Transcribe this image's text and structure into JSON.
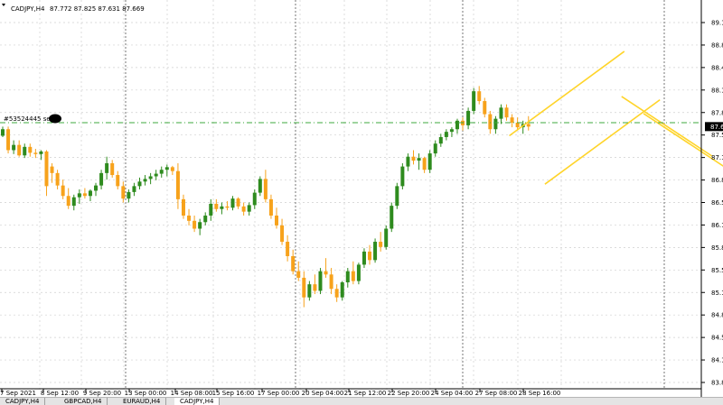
{
  "chart_data": {
    "type": "candlestick",
    "symbol_label": "CADJPY,H4",
    "ohlc_label": "87.772 87.825 87.631 87.669",
    "y_ticks": [
      "89.1",
      "88.8",
      "88.4",
      "88.1",
      "87.8",
      "87.5",
      "87.1",
      "86.8",
      "86.5",
      "86.1",
      "85.8",
      "85.5",
      "85.1",
      "84.8",
      "84.5",
      "84.1",
      "83.8"
    ],
    "current_price_label": "87.6",
    "x_ticks": [
      "7 Sep 2021",
      "8 Sep 12:00",
      "9 Sep 20:00",
      "13 Sep 00:00",
      "14 Sep 08:00",
      "15 Sep 16:00",
      "17 Sep 00:00",
      "20 Sep 04:00",
      "21 Sep 12:00",
      "22 Sep 20:00",
      "24 Sep 04:00",
      "27 Sep 08:00",
      "28 Sep 16:00"
    ],
    "order_label": "#53524445 sell",
    "order_price": 87.72,
    "ylim": [
      83.75,
      89.25
    ],
    "grid": true,
    "bull_color": "#2e8b1e",
    "bear_color": "#f7a21b",
    "channel_color": "#ffd42a",
    "order_line_color": "#3da83d",
    "candles": [
      [
        87.52,
        87.66,
        87.5,
        87.62
      ],
      [
        87.62,
        87.66,
        87.25,
        87.3
      ],
      [
        87.3,
        87.45,
        87.24,
        87.38
      ],
      [
        87.38,
        87.45,
        87.2,
        87.22
      ],
      [
        87.22,
        87.4,
        87.18,
        87.35
      ],
      [
        87.35,
        87.4,
        87.2,
        87.26
      ],
      [
        87.26,
        87.32,
        87.18,
        87.24
      ],
      [
        87.24,
        87.3,
        87.15,
        87.28
      ],
      [
        87.28,
        87.3,
        86.6,
        86.75
      ],
      [
        87.05,
        87.1,
        86.8,
        86.95
      ],
      [
        86.95,
        87.0,
        86.7,
        86.76
      ],
      [
        86.76,
        86.85,
        86.55,
        86.6
      ],
      [
        86.6,
        86.72,
        86.4,
        86.45
      ],
      [
        86.45,
        86.62,
        86.38,
        86.58
      ],
      [
        86.58,
        86.7,
        86.48,
        86.64
      ],
      [
        86.64,
        86.72,
        86.56,
        86.6
      ],
      [
        86.6,
        86.7,
        86.52,
        86.68
      ],
      [
        86.68,
        86.8,
        86.6,
        86.76
      ],
      [
        86.76,
        87.0,
        86.7,
        86.95
      ],
      [
        86.95,
        87.2,
        86.85,
        87.1
      ],
      [
        87.1,
        87.15,
        86.88,
        86.92
      ],
      [
        86.92,
        86.98,
        86.7,
        86.75
      ],
      [
        86.75,
        86.82,
        86.5,
        86.56
      ],
      [
        86.56,
        86.7,
        86.5,
        86.66
      ],
      [
        86.66,
        86.8,
        86.6,
        86.75
      ],
      [
        86.75,
        86.88,
        86.7,
        86.82
      ],
      [
        86.82,
        86.92,
        86.76,
        86.86
      ],
      [
        86.86,
        86.95,
        86.78,
        86.9
      ],
      [
        86.9,
        87.0,
        86.84,
        86.94
      ],
      [
        86.94,
        87.05,
        86.88,
        87.0
      ],
      [
        87.0,
        87.08,
        86.9,
        87.04
      ],
      [
        87.04,
        87.06,
        86.92,
        86.98
      ],
      [
        86.98,
        87.1,
        86.4,
        86.55
      ],
      [
        86.55,
        86.62,
        86.25,
        86.3
      ],
      [
        86.3,
        86.4,
        86.15,
        86.22
      ],
      [
        86.22,
        86.3,
        86.05,
        86.1
      ],
      [
        86.1,
        86.25,
        86.0,
        86.2
      ],
      [
        86.2,
        86.35,
        86.15,
        86.3
      ],
      [
        86.3,
        86.55,
        86.22,
        86.48
      ],
      [
        86.48,
        86.55,
        86.36,
        86.4
      ],
      [
        86.4,
        86.5,
        86.32,
        86.44
      ],
      [
        86.44,
        86.52,
        86.38,
        86.42
      ],
      [
        86.42,
        86.6,
        86.38,
        86.56
      ],
      [
        86.56,
        86.58,
        86.4,
        86.44
      ],
      [
        86.44,
        86.5,
        86.3,
        86.36
      ],
      [
        86.36,
        86.5,
        86.3,
        86.46
      ],
      [
        86.46,
        86.7,
        86.4,
        86.65
      ],
      [
        86.65,
        86.9,
        86.6,
        86.86
      ],
      [
        86.86,
        87.0,
        86.5,
        86.55
      ],
      [
        86.55,
        86.62,
        86.25,
        86.3
      ],
      [
        86.3,
        86.42,
        86.1,
        86.15
      ],
      [
        86.15,
        86.25,
        85.85,
        85.9
      ],
      [
        85.9,
        86.0,
        85.6,
        85.68
      ],
      [
        85.68,
        85.78,
        85.4,
        85.45
      ],
      [
        85.45,
        85.6,
        85.3,
        85.35
      ],
      [
        85.35,
        85.45,
        84.9,
        85.05
      ],
      [
        85.05,
        85.3,
        85.0,
        85.25
      ],
      [
        85.25,
        85.4,
        85.1,
        85.15
      ],
      [
        85.15,
        85.5,
        85.1,
        85.45
      ],
      [
        85.45,
        85.65,
        85.35,
        85.4
      ],
      [
        85.4,
        85.5,
        85.1,
        85.18
      ],
      [
        85.18,
        85.25,
        84.98,
        85.05
      ],
      [
        85.05,
        85.3,
        85.0,
        85.28
      ],
      [
        85.28,
        85.5,
        85.2,
        85.45
      ],
      [
        85.45,
        85.6,
        85.25,
        85.3
      ],
      [
        85.3,
        85.58,
        85.25,
        85.55
      ],
      [
        85.55,
        85.8,
        85.5,
        85.75
      ],
      [
        85.75,
        85.85,
        85.55,
        85.62
      ],
      [
        85.62,
        85.95,
        85.58,
        85.9
      ],
      [
        85.9,
        86.05,
        85.75,
        85.82
      ],
      [
        85.82,
        86.15,
        85.78,
        86.1
      ],
      [
        86.1,
        86.5,
        86.05,
        86.45
      ],
      [
        86.45,
        86.8,
        86.4,
        86.75
      ],
      [
        86.75,
        87.1,
        86.7,
        87.05
      ],
      [
        87.05,
        87.25,
        86.98,
        87.2
      ],
      [
        87.2,
        87.3,
        87.08,
        87.14
      ],
      [
        87.14,
        87.25,
        87.0,
        87.18
      ],
      [
        87.18,
        87.2,
        86.95,
        87.0
      ],
      [
        87.0,
        87.3,
        86.95,
        87.25
      ],
      [
        87.25,
        87.45,
        87.2,
        87.4
      ],
      [
        87.4,
        87.55,
        87.35,
        87.5
      ],
      [
        87.5,
        87.62,
        87.45,
        87.58
      ],
      [
        87.58,
        87.65,
        87.5,
        87.62
      ],
      [
        87.62,
        87.78,
        87.55,
        87.75
      ],
      [
        87.75,
        87.8,
        87.6,
        87.68
      ],
      [
        87.68,
        87.95,
        87.62,
        87.9
      ],
      [
        87.9,
        88.25,
        87.85,
        88.2
      ],
      [
        88.2,
        88.28,
        88.0,
        88.05
      ],
      [
        88.05,
        88.1,
        87.8,
        87.85
      ],
      [
        87.85,
        87.9,
        87.55,
        87.62
      ],
      [
        87.62,
        87.82,
        87.55,
        87.78
      ],
      [
        87.78,
        88.0,
        87.7,
        87.95
      ],
      [
        87.95,
        88.0,
        87.75,
        87.8
      ],
      [
        87.8,
        87.85,
        87.65,
        87.72
      ],
      [
        87.72,
        87.8,
        87.6,
        87.65
      ],
      [
        87.65,
        87.75,
        87.55,
        87.7
      ],
      [
        87.7,
        87.82,
        87.6,
        87.66
      ]
    ],
    "channels": [
      {
        "p1": [
          92.5,
          87.52
        ],
        "p2": [
          113.5,
          88.81
        ],
        "tip": [
          99,
          86.78
        ]
      },
      {
        "p1": [
          113.0,
          88.12
        ],
        "p2": [
          129.5,
          87.21
        ],
        "tip": [
          117,
          87.86
        ]
      }
    ]
  },
  "tabs": [
    "CADJPY,H4",
    "GBPCAD,H4",
    "EURAUD,H4",
    "CADJPY,H4"
  ]
}
